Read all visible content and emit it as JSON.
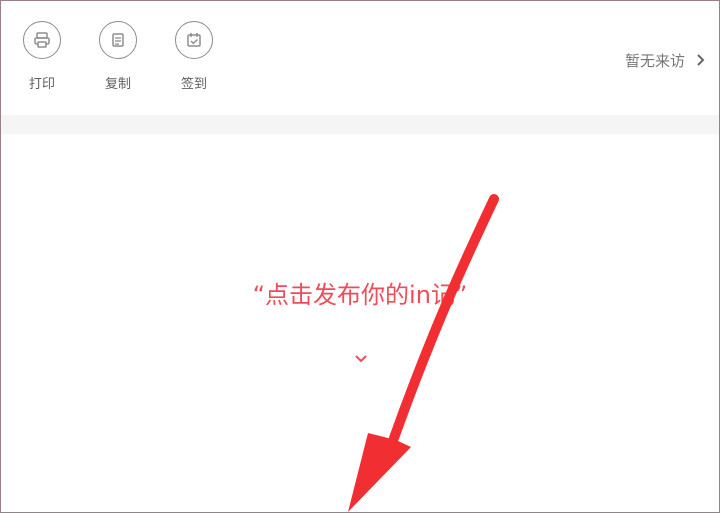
{
  "toolbar": {
    "items": [
      {
        "label": "打印",
        "icon": "printer-icon"
      },
      {
        "label": "复制",
        "icon": "copy-icon"
      },
      {
        "label": "签到",
        "icon": "calendar-icon"
      }
    ]
  },
  "visitors": {
    "text": "暂无来访"
  },
  "prompt": {
    "text": "“点击发布你的in记”"
  },
  "colors": {
    "accent": "#ef4c58",
    "arrow": "#f12f32",
    "divider": "#f5f5f5",
    "icon_outline": "#8d8d8d"
  }
}
